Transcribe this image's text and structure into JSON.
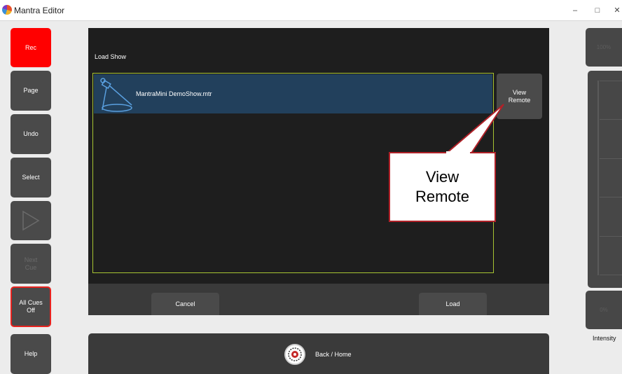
{
  "window": {
    "title": "Mantra Editor",
    "minimize": "–",
    "maximize": "□",
    "close": "✕"
  },
  "left_buttons": [
    {
      "label": "Rec",
      "state": "active",
      "color": "#ff0000"
    },
    {
      "label": "Page"
    },
    {
      "label": "Undo"
    },
    {
      "label": "Select"
    },
    {
      "label": "",
      "icon": "play-icon",
      "state": "disabled"
    },
    {
      "label": "Next\nCue",
      "state": "disabled"
    },
    {
      "label": "All Cues\nOff",
      "border_color": "#e8221e"
    },
    {
      "label": "Help"
    }
  ],
  "dialog": {
    "title": "Load Show",
    "files": [
      {
        "name": "MantraMini DemoShow.mtr",
        "icon": "spotlight-icon",
        "selected": true
      }
    ],
    "view_remote_label": "View\nRemote",
    "cancel_label": "Cancel",
    "load_label": "Load"
  },
  "bottom_bar": {
    "label": "Back / Home",
    "icon": "mantra-logo-icon"
  },
  "callout": {
    "text_line1": "View",
    "text_line2": "Remote",
    "border_color": "#b02128"
  },
  "right_panel": {
    "top_value": "100%",
    "bottom_value": "0%",
    "label": "Intensity"
  },
  "colors": {
    "selection_row": "#22405c",
    "list_border": "#a7c432",
    "dialog_bg": "#1e1e1e",
    "button_bg": "#4a4a4a"
  }
}
